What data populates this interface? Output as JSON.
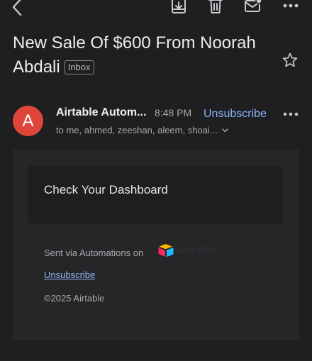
{
  "toolbar": {
    "back_icon": "back-arrow-icon",
    "archive_icon": "archive-icon",
    "delete_icon": "trash-icon",
    "mark_unread_icon": "mail-icon",
    "more_icon": "more-horizontal-icon"
  },
  "email": {
    "subject": "New Sale Of $600 From Noorah Abdali",
    "label": "Inbox",
    "sender_initial": "A",
    "sender_name": "Airtable Autom...",
    "time": "8:48 PM",
    "unsubscribe_label": "Unsubscribe",
    "recipients": "to me, ahmed, zeeshan, aleem, shoai...",
    "avatar_color": "#e0453a"
  },
  "body": {
    "dashboard_text": "Check Your Dashboard",
    "sent_via": "Sent via Automations on",
    "brand_name": "Airtable",
    "unsubscribe_link": "Unsubscribe",
    "copyright": "©2025 Airtable"
  },
  "colors": {
    "background": "#1f1f21",
    "link": "#8ab4f8"
  }
}
